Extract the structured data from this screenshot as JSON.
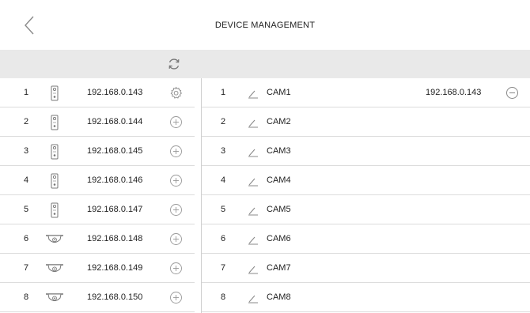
{
  "header": {
    "title": "DEVICE MANAGEMENT"
  },
  "icons": {
    "back": "chevron-left-icon",
    "refresh": "refresh-icon",
    "settings": "gear-icon",
    "add": "plus-circle-icon",
    "edit": "pencil-icon",
    "remove": "minus-circle-icon"
  },
  "devices": [
    {
      "num": "1",
      "type": "door-station",
      "ip": "192.168.0.143",
      "action": "settings"
    },
    {
      "num": "2",
      "type": "door-station",
      "ip": "192.168.0.144",
      "action": "add"
    },
    {
      "num": "3",
      "type": "door-station",
      "ip": "192.168.0.145",
      "action": "add"
    },
    {
      "num": "4",
      "type": "door-station",
      "ip": "192.168.0.146",
      "action": "add"
    },
    {
      "num": "5",
      "type": "door-station",
      "ip": "192.168.0.147",
      "action": "add"
    },
    {
      "num": "6",
      "type": "dome-camera",
      "ip": "192.168.0.148",
      "action": "add"
    },
    {
      "num": "7",
      "type": "dome-camera",
      "ip": "192.168.0.149",
      "action": "add"
    },
    {
      "num": "8",
      "type": "dome-camera",
      "ip": "192.168.0.150",
      "action": "add"
    }
  ],
  "cameras": [
    {
      "num": "1",
      "name": "CAM1",
      "ip": "192.168.0.143",
      "assigned": true
    },
    {
      "num": "2",
      "name": "CAM2",
      "ip": "",
      "assigned": false
    },
    {
      "num": "3",
      "name": "CAM3",
      "ip": "",
      "assigned": false
    },
    {
      "num": "4",
      "name": "CAM4",
      "ip": "",
      "assigned": false
    },
    {
      "num": "5",
      "name": "CAM5",
      "ip": "",
      "assigned": false
    },
    {
      "num": "6",
      "name": "CAM6",
      "ip": "",
      "assigned": false
    },
    {
      "num": "7",
      "name": "CAM7",
      "ip": "",
      "assigned": false
    },
    {
      "num": "8",
      "name": "CAM8",
      "ip": "",
      "assigned": false
    }
  ]
}
